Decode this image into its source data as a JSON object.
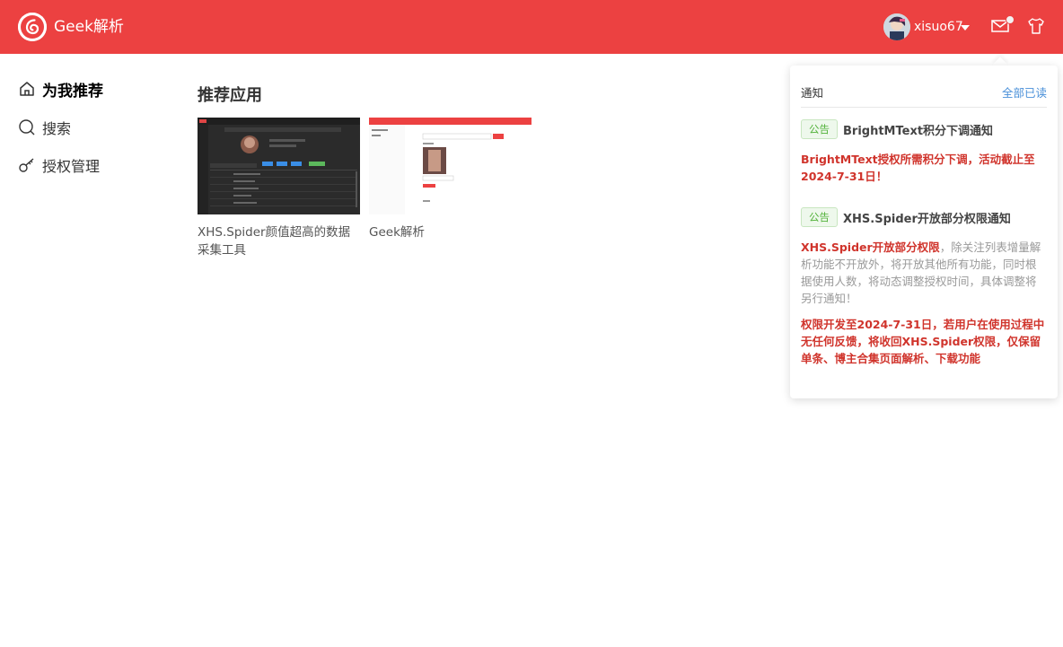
{
  "header": {
    "app_title": "Geek解析",
    "username": "xisuo67"
  },
  "sidebar": {
    "items": [
      {
        "label": "为我推荐",
        "icon": "home-icon",
        "active": true
      },
      {
        "label": "搜索",
        "icon": "search-icon",
        "active": false
      },
      {
        "label": "授权管理",
        "icon": "key-icon",
        "active": false
      }
    ]
  },
  "main": {
    "section_title": "推荐应用",
    "apps": [
      {
        "label": "XHS.Spider颜值超高的数据采集工具"
      },
      {
        "label": "Geek解析"
      }
    ]
  },
  "notifications": {
    "title": "通知",
    "mark_all_read": "全部已读",
    "items": [
      {
        "tag": "公告",
        "title": "BrightMText积分下调通知",
        "body_red": "BrightMText授权所需积分下调，活动截止至2024-7-31日！"
      },
      {
        "tag": "公告",
        "title": "XHS.Spider开放部分权限通知",
        "body_red_1": "XHS.Spider开放部分权限",
        "body_gray_1": "，除关注列表增量解析功能不开放外，将开放其他所有功能，同时根据使用人数，将动态调整授权时间，具体调整将另行通知！",
        "body_red_2": "权限开发至2024-7-31日，若用户在使用过程中无任何反馈，将收回XHS.Spider权限，仅保留单条、博主合集页面解析、下载功能"
      }
    ]
  },
  "colors": {
    "brand": "#ec4141",
    "link": "#4a90d9",
    "tag_green": "#52b23a",
    "alert_red": "#d0342c"
  }
}
